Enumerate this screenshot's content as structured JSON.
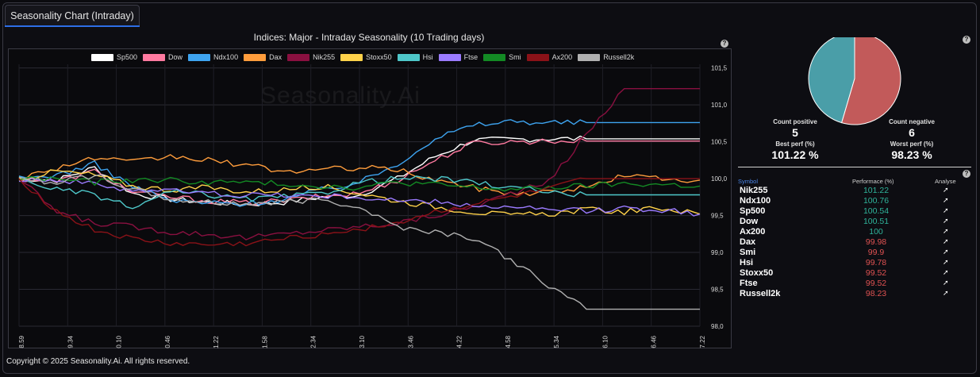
{
  "tab": {
    "label": "Seasonality Chart (Intraday)"
  },
  "chart": {
    "title": "Indices: Major - Intraday Seasonality (10 Trading days)",
    "watermark": "Seasonality.Ai",
    "help_icon": "?"
  },
  "stats": {
    "count_positive_label": "Count positive",
    "count_positive_value": "5",
    "count_negative_label": "Count negative",
    "count_negative_value": "6",
    "best_perf_label": "Best perf (%)",
    "best_perf_value": "101.22 %",
    "worst_perf_label": "Worst perf (%)",
    "worst_perf_value": "98.23 %"
  },
  "table": {
    "headers": {
      "symbol": "Symbol",
      "performance": "Performace (%)",
      "analyse": "Analyse"
    },
    "rows": [
      {
        "symbol": "Nik255",
        "perf": "101.22",
        "color": "#2fb39a"
      },
      {
        "symbol": "Ndx100",
        "perf": "100.76",
        "color": "#2fb39a"
      },
      {
        "symbol": "Sp500",
        "perf": "100.54",
        "color": "#2fb39a"
      },
      {
        "symbol": "Dow",
        "perf": "100.51",
        "color": "#2fb39a"
      },
      {
        "symbol": "Ax200",
        "perf": "100",
        "color": "#2fb39a"
      },
      {
        "symbol": "Dax",
        "perf": "99.98",
        "color": "#e05252"
      },
      {
        "symbol": "Smi",
        "perf": "99.9",
        "color": "#e05252"
      },
      {
        "symbol": "Hsi",
        "perf": "99.78",
        "color": "#e05252"
      },
      {
        "symbol": "Stoxx50",
        "perf": "99.52",
        "color": "#e05252"
      },
      {
        "symbol": "Ftse",
        "perf": "99.52",
        "color": "#e05252"
      },
      {
        "symbol": "Russell2k",
        "perf": "98.23",
        "color": "#e05252"
      }
    ],
    "analyse_icon": "rocket-icon"
  },
  "footer": {
    "copyright": "Copyright © 2025 Seasonality.Ai. All rights reserved."
  },
  "chart_data": [
    {
      "type": "line",
      "title": "Indices: Major - Intraday Seasonality (10 Trading days)",
      "x_ticks": [
        "08.59",
        "09.34",
        "10.10",
        "10.46",
        "11.22",
        "11.58",
        "12.34",
        "13.10",
        "13.46",
        "14.22",
        "14.58",
        "15.34",
        "16.10",
        "16.46",
        "17.22"
      ],
      "y_ticks": [
        "98,0",
        "98,5",
        "99,0",
        "99,5",
        "100,0",
        "100,5",
        "101,0",
        "101,5"
      ],
      "ylim": [
        98.0,
        101.55
      ],
      "legend_position": "top",
      "grid": true,
      "series": [
        {
          "name": "Sp500",
          "color": "#ffffff",
          "values": [
            100.0,
            99.98,
            100.15,
            99.8,
            99.72,
            99.68,
            99.65,
            99.68,
            99.75,
            99.78,
            100.0,
            100.3,
            100.52,
            100.53,
            100.54,
            100.54,
            100.54,
            100.54,
            100.54
          ]
        },
        {
          "name": "Dow",
          "color": "#ff7aa0",
          "values": [
            100.0,
            99.96,
            100.1,
            99.82,
            99.75,
            99.7,
            99.67,
            99.7,
            99.76,
            99.8,
            99.98,
            100.25,
            100.48,
            100.5,
            100.51,
            100.51,
            100.51,
            100.51,
            100.51
          ]
        },
        {
          "name": "Ndx100",
          "color": "#3ea4f0",
          "values": [
            100.0,
            100.05,
            100.2,
            99.9,
            99.7,
            99.67,
            99.66,
            99.72,
            99.85,
            99.95,
            100.2,
            100.55,
            100.72,
            100.78,
            100.76,
            100.76,
            100.76,
            100.76,
            100.76
          ]
        },
        {
          "name": "Dax",
          "color": "#ff9d3c",
          "values": [
            100.0,
            100.15,
            100.28,
            100.22,
            100.3,
            100.25,
            100.18,
            100.1,
            100.12,
            100.15,
            100.12,
            99.98,
            99.88,
            99.8,
            99.82,
            99.88,
            100.05,
            100.0,
            99.98
          ]
        },
        {
          "name": "Nik255",
          "color": "#8a1040",
          "values": [
            100.0,
            99.55,
            99.4,
            99.35,
            99.28,
            99.25,
            99.2,
            99.25,
            99.3,
            99.35,
            99.4,
            99.5,
            99.62,
            99.8,
            99.95,
            100.6,
            101.22,
            101.22,
            101.22
          ]
        },
        {
          "name": "Stoxx50",
          "color": "#ffd24a",
          "values": [
            100.0,
            100.1,
            100.05,
            99.9,
            99.85,
            99.88,
            99.82,
            99.85,
            99.9,
            99.8,
            99.7,
            99.62,
            99.55,
            99.5,
            99.52,
            99.58,
            99.55,
            99.6,
            99.52
          ]
        },
        {
          "name": "Hsi",
          "color": "#4ec7c9",
          "values": [
            100.0,
            99.85,
            99.78,
            99.6,
            99.82,
            99.78,
            99.72,
            99.75,
            99.8,
            99.95,
            100.0,
            100.0,
            99.95,
            99.88,
            99.82,
            99.78,
            99.78,
            99.78,
            99.78
          ]
        },
        {
          "name": "Ftse",
          "color": "#9b7bff",
          "values": [
            100.0,
            99.98,
            99.92,
            99.85,
            99.84,
            99.8,
            99.78,
            99.78,
            99.76,
            99.75,
            99.7,
            99.68,
            99.64,
            99.6,
            99.58,
            99.56,
            99.6,
            99.58,
            99.52
          ]
        },
        {
          "name": "Smi",
          "color": "#138a24",
          "values": [
            100.0,
            100.0,
            99.95,
            99.98,
            99.98,
            99.95,
            99.95,
            99.93,
            99.9,
            99.88,
            99.95,
            99.92,
            99.88,
            99.85,
            99.88,
            99.9,
            99.93,
            99.92,
            99.9
          ]
        },
        {
          "name": "Ax200",
          "color": "#8b1218",
          "values": [
            100.0,
            99.55,
            99.3,
            99.18,
            99.12,
            99.1,
            99.12,
            99.18,
            99.25,
            99.32,
            99.4,
            99.55,
            99.65,
            99.75,
            99.85,
            100.0,
            100.0,
            100.0,
            100.0
          ]
        },
        {
          "name": "Russell2k",
          "color": "#b0b0b0",
          "values": [
            100.0,
            99.95,
            100.05,
            99.85,
            99.72,
            99.68,
            99.66,
            99.68,
            99.72,
            99.62,
            99.35,
            99.28,
            99.2,
            98.9,
            98.55,
            98.23,
            98.23,
            98.23,
            98.23
          ]
        }
      ]
    },
    {
      "type": "pie",
      "categories": [
        "Count positive",
        "Count negative"
      ],
      "values": [
        5,
        6
      ],
      "colors": [
        "#4a9ea8",
        "#c25a5a"
      ]
    }
  ]
}
